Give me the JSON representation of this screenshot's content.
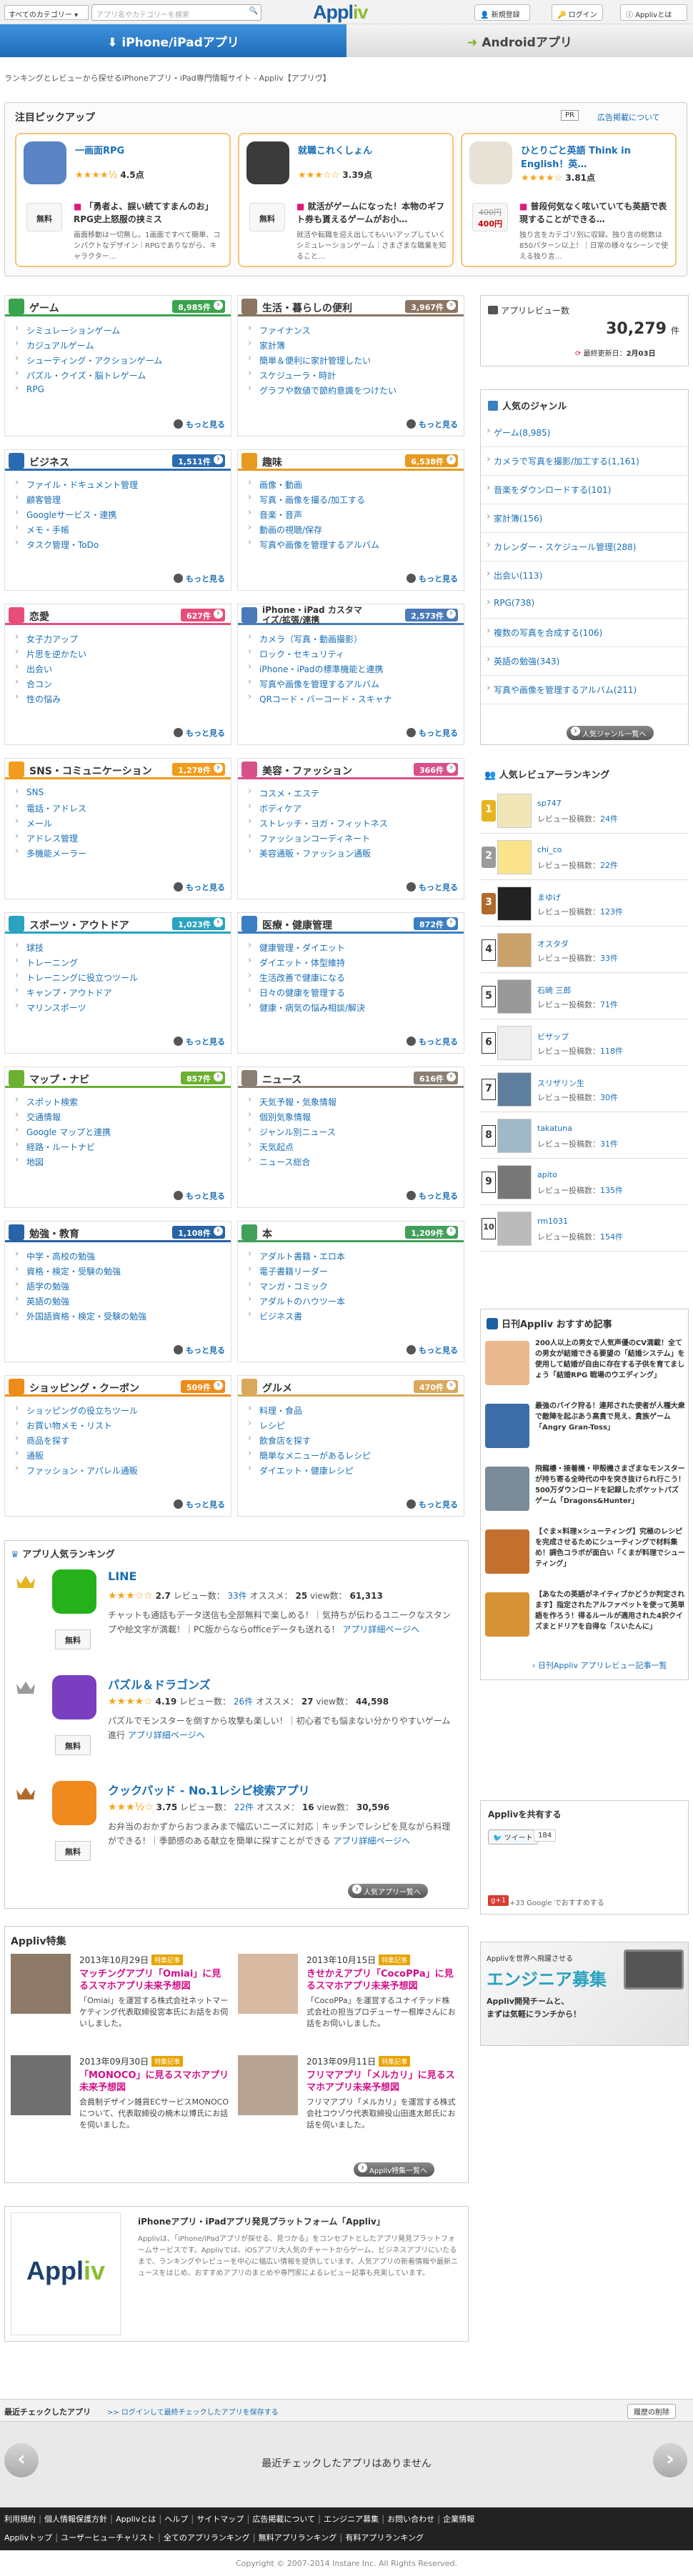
{
  "header": {
    "category_select": "すべてのカテゴリー",
    "search_placeholder": "アプリ名やカテゴリーを検索",
    "logo_main": "Appl",
    "logo_accent": "iv",
    "btn_signup": "新規登録",
    "btn_login": "ログイン",
    "btn_about": "Applivとは"
  },
  "platform_tabs": {
    "iphone": "iPhone/iPadアプリ",
    "android": "Androidアプリ"
  },
  "tagline": "ランキングとレビューから探せるiPhoneアプリ・iPad専門情報サイト - Appliv【アプリヴ】",
  "pickup": {
    "title": "注目ピックアップ",
    "pr": "PR",
    "ad_info": "広告掲載について",
    "cards": [
      {
        "name": "一画面RPG",
        "rating": "4.5点",
        "stars": "★★★★½",
        "price": "無料",
        "copy": "「勇者よ、誤い続てすまんのお」RPG史上怒服の挟ミス",
        "desc": "画面移動は一切無し。1画面ですべて簡単、コンパクトなデザイン｜RPGでありながら、キャラクター…",
        "icon_color": "#5a84c4"
      },
      {
        "name": "就職これくしょん",
        "rating": "3.39点",
        "stars": "★★★☆☆",
        "price": "無料",
        "copy": "就活がゲームになった！本物のギフト券も貰えるゲームがお小…",
        "desc": "就活や転職を迎え出してもいいアップしていくシミュレーションゲーム｜さまざまな職業を知ること…",
        "icon_color": "#3b3b3b"
      },
      {
        "name": "ひとりごと英語 Think in English！英…",
        "rating": "3.81点",
        "stars": "★★★★☆",
        "price_old": "400円",
        "price": "400円",
        "copy": "普段何気なく呟いていても英語で表現することができる…",
        "desc": "独り言をカテゴリ別に収録。独り言の総数は850パターン以上！｜日常の様々なシーンで使える独り言…",
        "icon_color": "#e8e2d6"
      }
    ]
  },
  "genres": [
    {
      "name": "ゲーム",
      "count": "8,985件",
      "color": "#3aa34d",
      "items": [
        "シミュレーションゲーム",
        "カジュアルゲーム",
        "シューティング・アクションゲーム",
        "パズル・クイズ・脳トレゲーム",
        "RPG"
      ],
      "more": "もっと見る"
    },
    {
      "name": "生活・暮らしの便利",
      "count": "3,967件",
      "color": "#8c7561",
      "items": [
        "ファイナンス",
        "家計簿",
        "簡単＆便利に家計管理したい",
        "スケジューラ・時計",
        "グラフや数値で節約意識をつけたい"
      ],
      "more": "もっと見る"
    },
    {
      "name": "ビジネス",
      "count": "1,511件",
      "color": "#2b6cb0",
      "items": [
        "ファイル・ドキュメント管理",
        "顧客管理",
        "Googleサービス・連携",
        "メモ・手帳",
        "タスク管理・ToDo"
      ],
      "more": "もっと見る"
    },
    {
      "name": "趣味",
      "count": "6,538件",
      "color": "#e79a20",
      "items": [
        "画像・動画",
        "写真・画像を撮る/加工する",
        "音楽・音声",
        "動画の視聴/保存",
        "写真や画像を管理するアルバム"
      ],
      "more": "もっと見る"
    },
    {
      "name": "恋愛",
      "count": "627件",
      "color": "#e84d7a",
      "items": [
        "女子力アップ",
        "片思を逆かたい",
        "出会い",
        "合コン",
        "性の悩み"
      ],
      "more": "もっと見る"
    },
    {
      "name": "iPhone・iPad カスタマイズ/拡張/連携",
      "count": "2,573件",
      "color": "#4a7ab8",
      "items": [
        "カメラ（写真・動画撮影）",
        "ロック・セキュリティ",
        "iPhone・iPadの標準機能と連携",
        "写真や画像を管理するアルバム",
        "QRコード・バーコード・スキャナ"
      ],
      "more": "もっと見る"
    },
    {
      "name": "SNS・コミュニケーション",
      "count": "1,278件",
      "color": "#f29b1c",
      "items": [
        "SNS",
        "電話・アドレス",
        "メール",
        "アドレス管理",
        "多機能メーラー"
      ],
      "more": "もっと見る"
    },
    {
      "name": "美容・ファッション",
      "count": "366件",
      "color": "#d8508a",
      "items": [
        "コスメ・エステ",
        "ボディケア",
        "ストレッチ・ヨガ・フィットネス",
        "ファッションコーディネート",
        "美容通販・ファッション通販"
      ],
      "more": "もっと見る"
    },
    {
      "name": "スポーツ・アウトドア",
      "count": "1,023件",
      "color": "#2aa3bf",
      "items": [
        "球技",
        "トレーニング",
        "トレーニングに役立つツール",
        "キャンプ・アウトドア",
        "マリンスポーツ"
      ],
      "more": "もっと見る"
    },
    {
      "name": "医療・健康管理",
      "count": "872件",
      "color": "#3c7fc4",
      "items": [
        "健康管理・ダイエット",
        "ダイエット・体型維持",
        "生活改善で健康になる",
        "日々の健康を管理する",
        "健康・病気の悩み相談/解決"
      ],
      "more": "もっと見る"
    },
    {
      "name": "マップ・ナビ",
      "count": "857件",
      "color": "#6bb031",
      "items": [
        "スポット検索",
        "交通情報",
        "Google マップと連携",
        "経路・ルートナビ",
        "地図"
      ],
      "more": "もっと見る"
    },
    {
      "name": "ニュース",
      "count": "616件",
      "color": "#8a7f72",
      "items": [
        "天気予報・気象情報",
        "個別気象情報",
        "ジャンル別ニュース",
        "天気起点",
        "ニュース総合"
      ],
      "more": "もっと見る"
    },
    {
      "name": "勉強・教育",
      "count": "1,108件",
      "color": "#2863a8",
      "items": [
        "中学・高校の勉強",
        "資格・検定・受験の勉強",
        "語学の勉強",
        "英語の勉強",
        "外国語資格・検定・受験の勉強"
      ],
      "more": "もっと見る"
    },
    {
      "name": "本",
      "count": "1,209件",
      "color": "#42a05a",
      "items": [
        "アダルト書籍・エロ本",
        "電子書籍リーダー",
        "マンガ・コミック",
        "アダルトのハウツー本",
        "ビジネス書"
      ],
      "more": "もっと見る"
    },
    {
      "name": "ショッピング・クーポン",
      "count": "509件",
      "color": "#ee8c1a",
      "items": [
        "ショッピングの役立ちツール",
        "お買い物メモ・リスト",
        "商品を探す",
        "通販",
        "ファッション・アパレル通販"
      ],
      "more": "もっと見る"
    },
    {
      "name": "グルメ",
      "count": "470件",
      "color": "#d9a85a",
      "items": [
        "料理・食品",
        "レシピ",
        "飲食店を探す",
        "簡単なメニューがあるレシピ",
        "ダイエット・健康レシピ"
      ],
      "more": "もっと見る"
    }
  ],
  "review_box": {
    "title": "アプリレビュー数",
    "count": "30,279",
    "unit": "件",
    "updated_label": "最終更新日：",
    "updated": "2月03日"
  },
  "popular_genres": {
    "title": "人気のジャンル",
    "items": [
      "ゲーム(8,985)",
      "カメラで写真を撮影/加工する(1,161)",
      "音楽をダウンロードする(101)",
      "家計簿(156)",
      "カレンダー・スケジュール管理(288)",
      "出会い(113)",
      "RPG(738)",
      "複数の写真を合成する(106)",
      "英語の勉強(343)",
      "写真や画像を管理するアルバム(211)"
    ],
    "button": "人気ジャンル一覧へ"
  },
  "reviewer_ranking": {
    "title": "人気レビュアーランキング",
    "posts_label": "レビュー投稿数：",
    "rows": [
      {
        "rank": "1",
        "name": "sp747",
        "posts": "24件"
      },
      {
        "rank": "2",
        "name": "chi_co",
        "posts": "22件"
      },
      {
        "rank": "3",
        "name": "まゆげ",
        "posts": "123件"
      },
      {
        "rank": "4",
        "name": "オスタダ",
        "posts": "33件"
      },
      {
        "rank": "5",
        "name": "石崎 三郎",
        "posts": "71件"
      },
      {
        "rank": "6",
        "name": "ビザップ",
        "posts": "118件"
      },
      {
        "rank": "7",
        "name": "スリザリン生",
        "posts": "30件"
      },
      {
        "rank": "8",
        "name": "takatuna",
        "posts": "31件"
      },
      {
        "rank": "9",
        "name": "apito",
        "posts": "135件"
      },
      {
        "rank": "10",
        "name": "rm1031",
        "posts": "154件"
      }
    ]
  },
  "osusume": {
    "title": "日刊Appliv おすすめ記事",
    "items": [
      {
        "lead": "200人以上の男女で人気声優のCV満載！全ての男女が結婚できる要望の「結婚システム」を使用して結婚が自由に存在する子供を育てましょう「結婚RPG 戦場のウエディング」",
        "color": "#e9b88f"
      },
      {
        "lead": "最強のバイク狩る！連邦された使者が人種大衆で敵陣を起ぶあう高貴で見え、貴族ゲーム「Angry Gran-Toss」",
        "color": "#3c6da6"
      },
      {
        "lead": "飛龍樓・接着機・甲殻機さまざまなモンスターが持ち寄る全時代の中を突き抜けられ行こう！500万ダウンロードを記録したポケットパズゲーム「Dragons&Hunter」",
        "color": "#7a8c99"
      },
      {
        "lead": "【ぐま×料理×シューティング】究極のレシピを完成させるためにシューティングで材料集め！調色コラボが面白い「くまが料理でシューティング」",
        "color": "#c46f2e"
      },
      {
        "lead": "【あなたの英語がネイティブかどうか判定されます】指定されたアルファベットを使って英単語を作ろう！得るルールが適用された4択クイズまとドリアを自得な「スいたんに」",
        "color": "#d79236"
      }
    ],
    "link": "日刊Appliv アプリレビュー記事一覧"
  },
  "social": {
    "title": "Applivを共有する",
    "tweet": "ツイート",
    "tweet_count": "184",
    "gplus": "g+1",
    "gplus_count": "+33",
    "gplus_text": "Google でおすすめする"
  },
  "engineer_banner": {
    "line1": "Applivを世界へ飛躍させる",
    "headline": "エンジニア募集",
    "sub1": "Appliv開発チームと、",
    "sub2": "まずは気軽にランチから！"
  },
  "app_ranking": {
    "title": "アプリ人気ランキング",
    "review_label": "レビュー数：",
    "osusume_label": "オススメ：",
    "views_label": "view数：",
    "detail_link": "アプリ詳細ページへ",
    "button": "人気アプリ一覧へ",
    "apps": [
      {
        "name": "LINE",
        "rating": "2.7",
        "stars": "★★★☆☆",
        "reviews": "33件",
        "osusume": "25",
        "views": "61,313",
        "price": "無料",
        "desc": "チャットも通話もデータ送信も全部無料で楽しめる！｜気持ちが伝わるユニークなスタンプや絵文字が満載！｜PC版からならofficeデータも送れる！",
        "color": "#26b11a",
        "crown": "#e6b422"
      },
      {
        "name": "パズル＆ドラゴンズ",
        "rating": "4.19",
        "stars": "★★★★☆",
        "reviews": "26件",
        "osusume": "27",
        "views": "44,598",
        "price": "無料",
        "desc": "パズルでモンスターを倒すから攻撃も楽しい！｜初心者でも悩まない分かりやすいゲーム進行",
        "color": "#7a3ec1",
        "crown": "#9a9a9a"
      },
      {
        "name": "クックパッド - No.1レシピ検索アプリ",
        "rating": "3.75",
        "stars": "★★★½☆",
        "reviews": "22件",
        "osusume": "16",
        "views": "30,596",
        "price": "無料",
        "desc": "お弁当のおかずからおつまみまで幅広いニーズに対応｜キッチンでレシピを見ながら料理ができる！｜季節感のある献立を簡単に探すことができる",
        "color": "#f08a1e",
        "crown": "#b06a2c"
      }
    ]
  },
  "feature": {
    "title": "Appliv特集",
    "tag": "特集記事",
    "button": "Appliv特集一覧へ",
    "items": [
      {
        "date": "2013年10月29日",
        "title": "マッチングアプリ「Omiai」に見るスマホアプリ未来予想図",
        "desc": "「Omiai」を運営する株式会社ネットマーケティング代表取締役宮本氏にお話をお伺いしました。"
      },
      {
        "date": "2013年10月15日",
        "title": "きせかえアプリ「CocoPPa」に見るスマホアプリ未来予想図",
        "desc": "「CocoPPa」を運営するユナイテッド株式会社の担当プロデューサー根岸さんにお話をお伺いしました。"
      },
      {
        "date": "2013年09月30日",
        "title": "「MONOCO」に見るスマホアプリ未来予想図",
        "desc": "会員制デザイン雑貨ECサービスMONOCOについて、代表取締役の楠木以博氏にお話を伺いました。"
      },
      {
        "date": "2013年09月11日",
        "title": "フリマアプリ「メルカリ」に見るスマホアプリ未来予想図",
        "desc": "フリマアプリ「メルカリ」を運営する株式会社コウゾウ代表取締役山田進太郎氏にお話を伺いました。"
      }
    ]
  },
  "platform_info": {
    "heading": "iPhoneアプリ・iPadアプリ発見プラットフォーム「Appliv」",
    "body": "Applivは、「iPhone/iPadアプリが探せる、見つかる」をコンセプトとしたアプリ発見プラットフォームサービスです。Applivでは、iOSアプリ大人気のチャートからゲーム、ビジネスアプリにいたるまで、ランキングやレビューを中心に幅広い情報を提供しています。人気アプリの新着情報や最新ニュースをはじめ、おすすめアプリのまとめや専門家によるレビュー記事も充実しています。"
  },
  "recent": {
    "title": "最近チェックしたアプリ",
    "login_note": ">> ログインして最終チェックしたアプリを保存する",
    "delete": "履歴の削除",
    "empty": "最近チェックしたアプリはありません"
  },
  "footer": {
    "row1": [
      "利用規約",
      "個人情報保護方針",
      "Applivとは",
      "ヘルプ",
      "サイトマップ",
      "広告掲載について",
      "エンジニア募集",
      "お問い合わせ",
      "企業情報"
    ],
    "row2": [
      "Applivトップ",
      "ユーザーヒューチャリスト",
      "全てのアプリランキング",
      "無料アプリランキング",
      "有料アプリランキング"
    ],
    "copyright": "Copyright © 2007-2014 Instare Inc. All Rights Reserved."
  }
}
